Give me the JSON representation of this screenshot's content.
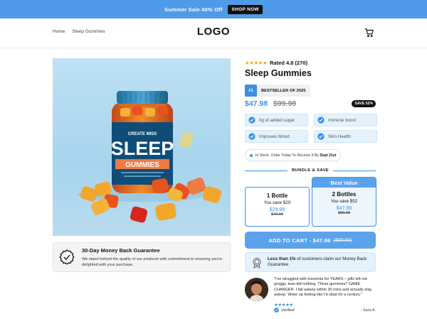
{
  "promo": {
    "text": "Summer Sale 40% Off",
    "button": "SHOP NOW"
  },
  "header": {
    "nav": [
      "Home",
      "Sleep Gummies"
    ],
    "logo": "LOGO",
    "cart_icon": "cart-icon"
  },
  "product": {
    "image_label_top": "CREATE MISS",
    "image_label_main": "SLEEP",
    "image_label_band": "GUMMIES",
    "rating_stars": "★★★★★",
    "rating_text": "Rated 4.8 (270)",
    "title": "Sleep Gummies",
    "bestseller_badge": "#1",
    "bestseller_text": "BESTSELLER OF 2025",
    "price_now": "$47.98",
    "price_old": "$99.98",
    "save_badge": "SAVE 52%",
    "benefits": [
      "0g of added sugar",
      "Immune boost",
      "Improves Mood",
      "Skin Health"
    ],
    "stock_prefix": "In Stock, Order Today To Receive It By",
    "stock_date": "Sept 21st"
  },
  "bundles": {
    "heading": "BUNDLE & SAVE",
    "options": [
      {
        "name": "1 Bottle",
        "save": "You save $20",
        "price": "$29.99",
        "old": "$49.99"
      },
      {
        "tag": "Best Value",
        "name": "2 Bottles",
        "save": "You save $52",
        "price": "$47.98",
        "old": "$99.98"
      }
    ]
  },
  "cta": {
    "label": "ADD TO CART - $47.98",
    "old_price": "($99.98)"
  },
  "insomnia": {
    "bold": "Less than 1%",
    "rest": " of customers claim our Money Back Guarantee"
  },
  "guarantee": {
    "title": "30-Day Money Back Guarantee",
    "desc": "We stand behind the quality of our products with commitment to ensuring you're delighted with your purchase."
  },
  "review": {
    "quote": "\"I've struggled with insomnia for YEARS – pills left me groggy, teas did nothing. These gummies? GAME CHANGER. I fall asleep within 30 mins and actually stay asleep. Woke up feeling like I'd slept for a century.\"",
    "stars": "★★★★★",
    "verified": "Verified",
    "reviewer": "- Sara A."
  },
  "colors": {
    "accent": "#3b8fe8",
    "promo_bg": "#4f9be8",
    "button": "#5aa3ec",
    "star": "#f2a91c",
    "benefit_bg": "#e4f2fc"
  }
}
